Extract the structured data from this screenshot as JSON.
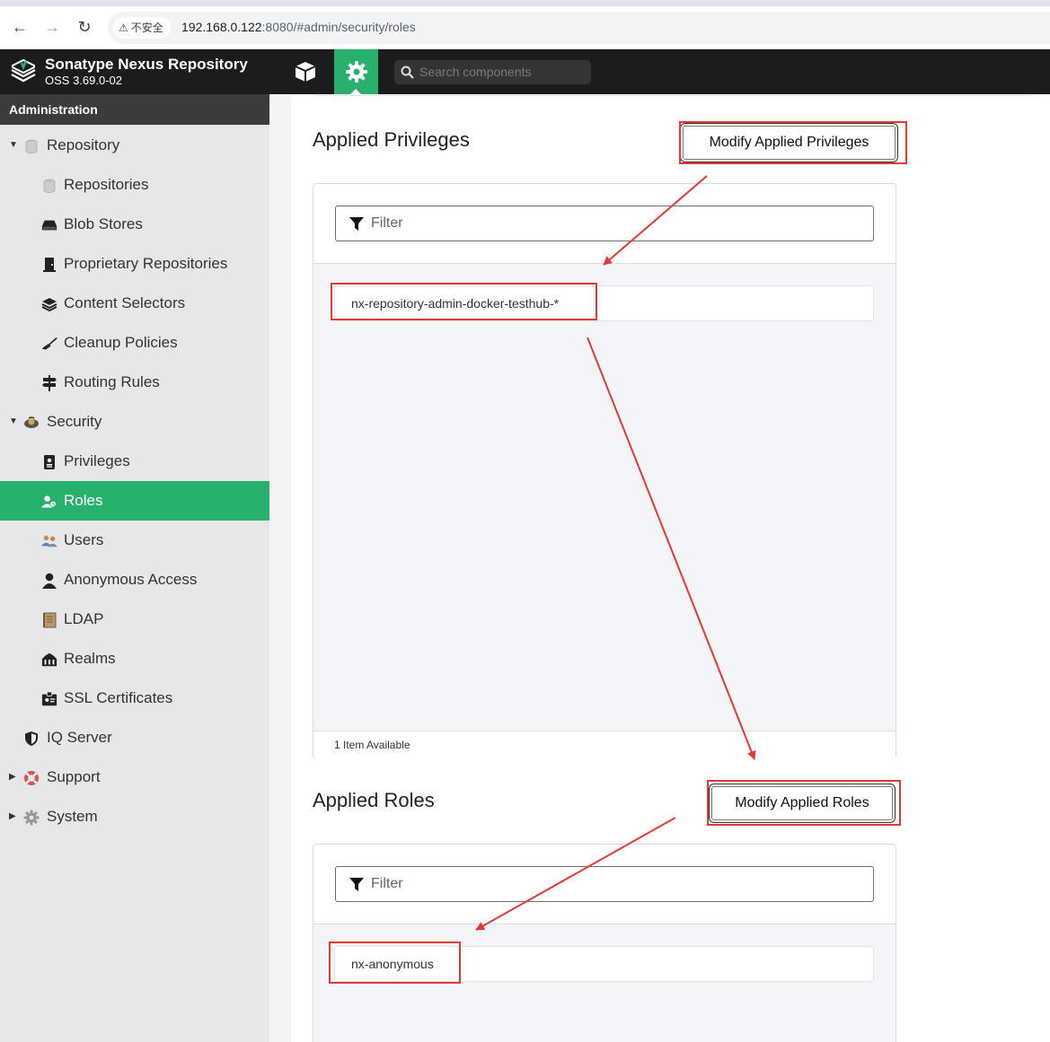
{
  "browser": {
    "back_icon": "←",
    "forward_icon": "→",
    "reload_icon": "↻",
    "security_label": "不安全",
    "url_host": "192.168.0.122",
    "url_rest": ":8080/#admin/security/roles"
  },
  "header": {
    "brand_title": "Sonatype Nexus Repository",
    "brand_version": "OSS 3.69.0-02",
    "search_placeholder": "Search components",
    "colors": {
      "header_bg": "#1b1c1d",
      "accent": "#27b06e"
    }
  },
  "sidebar": {
    "heading": "Administration",
    "items": [
      {
        "label": "Repository",
        "icon": "database-icon",
        "level": 0,
        "expanded": true
      },
      {
        "label": "Repositories",
        "icon": "database-icon",
        "level": 1
      },
      {
        "label": "Blob Stores",
        "icon": "hard-drive-icon",
        "level": 1
      },
      {
        "label": "Proprietary Repositories",
        "icon": "door-icon",
        "level": 1
      },
      {
        "label": "Content Selectors",
        "icon": "layers-icon",
        "level": 1
      },
      {
        "label": "Cleanup Policies",
        "icon": "broom-icon",
        "level": 1
      },
      {
        "label": "Routing Rules",
        "icon": "signpost-icon",
        "level": 1
      },
      {
        "label": "Security",
        "icon": "badge-icon",
        "level": 0,
        "expanded": true
      },
      {
        "label": "Privileges",
        "icon": "id-card-icon",
        "level": 1
      },
      {
        "label": "Roles",
        "icon": "user-roles-icon",
        "level": 1,
        "active": true
      },
      {
        "label": "Users",
        "icon": "users-icon",
        "level": 1
      },
      {
        "label": "Anonymous Access",
        "icon": "user-icon",
        "level": 1
      },
      {
        "label": "LDAP",
        "icon": "book-icon",
        "level": 1
      },
      {
        "label": "Realms",
        "icon": "realms-icon",
        "level": 1
      },
      {
        "label": "SSL Certificates",
        "icon": "certificate-icon",
        "level": 1
      },
      {
        "label": "IQ Server",
        "icon": "shield-icon",
        "level": 0
      },
      {
        "label": "Support",
        "icon": "lifebuoy-icon",
        "level": 0,
        "expanded": false
      },
      {
        "label": "System",
        "icon": "gear-icon",
        "level": 0,
        "expanded": false
      }
    ]
  },
  "privileges": {
    "title": "Applied Privileges",
    "modify_label": "Modify Applied Privileges",
    "filter_placeholder": "Filter",
    "items": [
      "nx-repository-admin-docker-testhub-*"
    ],
    "footer": "1 Item Available"
  },
  "roles": {
    "title": "Applied Roles",
    "modify_label": "Modify Applied Roles",
    "filter_placeholder": "Filter",
    "items": [
      "nx-anonymous"
    ]
  },
  "annotation_color": "#e53935"
}
